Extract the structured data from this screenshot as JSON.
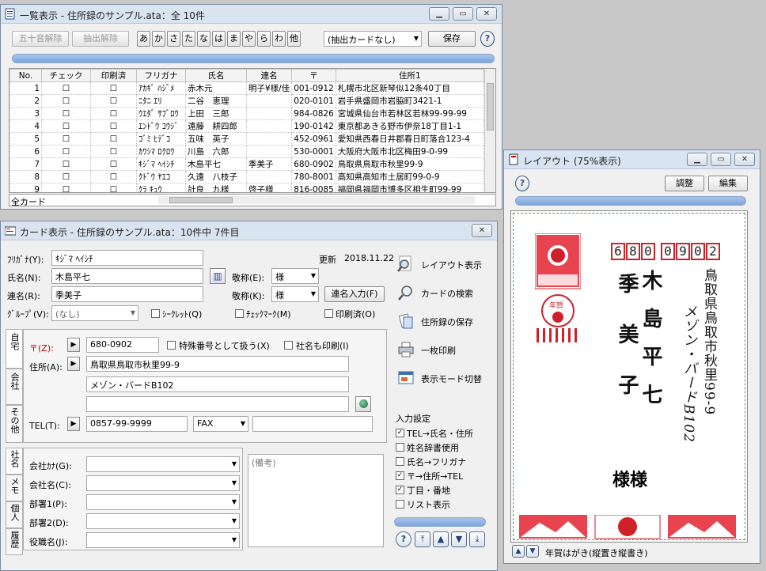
{
  "list_window": {
    "title": "一覧表示 - 住所録のサンプル.ata：全 10件",
    "toolbar": {
      "kana_reset": "五十音解除",
      "extract_reset": "抽出解除",
      "kana_keys": [
        "あ",
        "か",
        "さ",
        "た",
        "な",
        "は",
        "ま",
        "や",
        "ら",
        "わ",
        "他"
      ],
      "extract_select": "(抽出カードなし)",
      "save": "保存",
      "help": "?"
    },
    "columns": [
      "No.",
      "チェック",
      "印刷済",
      "フリガナ",
      "氏名",
      "連名",
      "〒",
      "住所1"
    ],
    "rows": [
      {
        "no": "1",
        "kana": "ｱｶｷﾞ ﾊｼﾞﾒ",
        "name": "赤木元",
        "renmei": "明子¥様/佳",
        "zip": "001-0912",
        "addr": "札幌市北区新琴似12条40丁目"
      },
      {
        "no": "2",
        "kana": "ﾆﾀﾆ ｴﾘ",
        "name": "二谷　恵理",
        "renmei": "",
        "zip": "020-0101",
        "addr": "岩手県盛岡市岩脇町3421-1"
      },
      {
        "no": "3",
        "kana": "ｳｴﾀﾞ ｻﾌﾞﾛｳ",
        "name": "上田　三郎",
        "renmei": "",
        "zip": "984-0826",
        "addr": "宮城県仙台市若林区若林99-99-99"
      },
      {
        "no": "4",
        "kana": "ｴﾝﾄﾞｳ ｺｳｼﾞ",
        "name": "遠藤　耕四郎",
        "renmei": "",
        "zip": "190-0142",
        "addr": "東京都あきる野市伊奈18丁目1-1"
      },
      {
        "no": "5",
        "kana": "ｺﾞﾐ ﾋﾃﾞｺ",
        "name": "五味　英子",
        "renmei": "",
        "zip": "452-0961",
        "addr": "愛知県西春日井郡春日町落合123-4"
      },
      {
        "no": "6",
        "kana": "ｶﾜｼﾏ ﾛｸﾛｳ",
        "name": "川島　六郎",
        "renmei": "",
        "zip": "530-0001",
        "addr": "大阪府大阪市北区梅田9-0-99"
      },
      {
        "no": "7",
        "kana": "ｷｼﾞﾏ ﾍｲｼﾁ",
        "name": "木島平七",
        "renmei": "季美子",
        "zip": "680-0902",
        "addr": "鳥取県鳥取市秋里99-9"
      },
      {
        "no": "8",
        "kana": "ｸﾄﾞｳ ﾔｴｺ",
        "name": "久遠　八枝子",
        "renmei": "",
        "zip": "780-8001",
        "addr": "高知県高知市土居町99-0-9"
      },
      {
        "no": "9",
        "kana": "ｸﾗ ｷｭｳ",
        "name": "計良　九様",
        "renmei": "啓子様",
        "zip": "816-0085",
        "addr": "福岡県福岡市博多区相生町99-99"
      }
    ],
    "footer": "全カード"
  },
  "card_window": {
    "title": "カード表示 - 住所録のサンプル.ata：10件中 7件目",
    "kana_label": "ﾌﾘｶﾞﾅ(Y):",
    "kana_value": "ｷｼﾞﾏ ﾍｲｼﾁ",
    "updated_label": "更新",
    "updated_value": "2018.11.22",
    "name_label": "氏名(N):",
    "name_value": "木島平七",
    "honorific_label": "敬称(E):",
    "honorific_value": "様",
    "renmei_label": "連名(R):",
    "renmei_value": "季美子",
    "honorific2_label": "敬称(K):",
    "honorific2_value": "様",
    "renmei_input": "連名入力(F)",
    "group_label": "ｸﾞﾙｰﾌﾟ(V):",
    "group_value": "(なし)",
    "secret_label": "ｼｰｸﾚｯﾄ(Q)",
    "checkmark_label": "ﾁｪｯｸﾏｰｸ(M)",
    "printed_label": "印刷済(O)",
    "tabs": [
      "自宅",
      "会社",
      "その他"
    ],
    "tabs2": [
      "社名",
      "メモ",
      "個人",
      "履歴"
    ],
    "zip_label": "〒(Z):",
    "zip_value": "680-0902",
    "special_zip": "特殊番号として扱う(X)",
    "print_company": "社名も印刷(I)",
    "addr_label": "住所(A):",
    "addr1": "鳥取県鳥取市秋里99-9",
    "addr2": "メゾン・バードB102",
    "addr3": "",
    "tel_label": "TEL(T):",
    "tel_value": "0857-99-9999",
    "fax_select": "FAX",
    "fax_value": "",
    "company_fields": [
      {
        "label": "会社ｶﾅ(G):"
      },
      {
        "label": "会社名(C):"
      },
      {
        "label": "部署1(P):"
      },
      {
        "label": "部署2(D):"
      },
      {
        "label": "役職名(J):"
      }
    ],
    "memo_placeholder": "(備考)",
    "side_buttons": [
      "レイアウト表示",
      "カードの検索",
      "住所録の保存",
      "一枚印刷",
      "表示モード切替"
    ],
    "input_settings_title": "入力設定",
    "input_settings": [
      {
        "label": "TEL→氏名・住所",
        "checked": true
      },
      {
        "label": "姓名辞書使用",
        "checked": false
      },
      {
        "label": "氏名→フリガナ",
        "checked": false
      },
      {
        "label": "〒→住所→TEL",
        "checked": true
      },
      {
        "label": "丁目・番地",
        "checked": true
      },
      {
        "label": "リスト表示",
        "checked": false
      }
    ]
  },
  "layout_window": {
    "title": "レイアウト (75%表示)",
    "adjust": "調整",
    "edit": "編集",
    "postcard": {
      "zip_digits": [
        "6",
        "8",
        "0",
        "0",
        "9",
        "0",
        "2"
      ],
      "address_line1": "鳥取県鳥取市秋里99-9",
      "address_line2": "メゾン・バードB102",
      "name": "木島平七",
      "renmei": "季美子",
      "sama": "様様",
      "stamp_text": "年賀"
    },
    "status": "年賀はがき(縦置き縦書き)"
  },
  "colors": {
    "accent": "#7ea4dc",
    "postal_red": "#d0202a"
  }
}
